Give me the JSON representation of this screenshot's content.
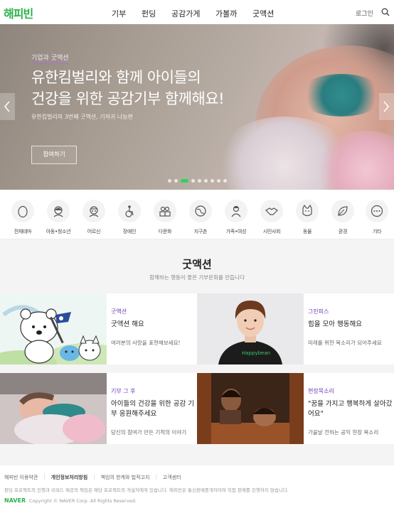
{
  "header": {
    "logo": "해피빈",
    "nav": [
      "기부",
      "펀딩",
      "공감가게",
      "가볼까",
      "굿액션"
    ],
    "login": "로그인",
    "search_icon": "search-icon"
  },
  "hero": {
    "tag": "기업과 굿액션",
    "title_line1": "유한킴벌리와 함께 아이들의",
    "title_line2": "건강을 위한 공감기부 함께해요!",
    "subtitle": "유한킴벌리의 3번째 굿액션, 기저귀 나눔편",
    "button": "참여하기",
    "slide_count": 9,
    "active_slide": 3,
    "accent_color": "#2bd55b"
  },
  "categories": [
    {
      "label": "전체테마",
      "icon": "egg-icon"
    },
    {
      "label": "아동•청소년",
      "icon": "child-icon"
    },
    {
      "label": "어르신",
      "icon": "elder-icon"
    },
    {
      "label": "장애인",
      "icon": "wheelchair-icon"
    },
    {
      "label": "다문화",
      "icon": "people-icon"
    },
    {
      "label": "지구촌",
      "icon": "globe-icon"
    },
    {
      "label": "가족•여성",
      "icon": "woman-icon"
    },
    {
      "label": "시민사회",
      "icon": "handshake-icon"
    },
    {
      "label": "동물",
      "icon": "cat-icon"
    },
    {
      "label": "환경",
      "icon": "leaf-icon"
    },
    {
      "label": "기타",
      "icon": "more-icon"
    }
  ],
  "goodaction": {
    "title": "굿액션",
    "subtitle": "함께하는 행동이 좋은 기부문화를 만듭니다",
    "cards": [
      {
        "kicker": "굿액션",
        "title": "굿액션 해요",
        "desc": "여러분의 사랑을 표현해보세요!"
      },
      {
        "kicker": "그린피스",
        "title": "힘을 모아 행동해요",
        "desc": "미래를 위한 목소리가 되어주세요"
      },
      {
        "kicker": "기부 그 후",
        "title": "아이들의 건강을 위한 공감 기부 응원해주세요",
        "desc": "당신의 참여가 만든 기적의 이야기"
      },
      {
        "kicker": "현장목소리",
        "title": "\"꿈을 가지고 행복하게 살아갔어요\"",
        "desc": "가을날 전하는 공익 현장 목소리"
      }
    ],
    "shirt_text": "Happybean",
    "kicker_color": "#6a3bb8"
  },
  "footer": {
    "links": [
      "해피빈 이용약관",
      "개인정보처리방침",
      "책임의 한계와 법적고지",
      "고객센터"
    ],
    "note": "펀딩 프로젝트의 진행과 리워드 제공의 책임은 해당 프로젝트의 개설자에게 있습니다. 해피빈은 통신판매중개자이며 직접 판매를 진행하지 않습니다.",
    "brand": "NAVER",
    "copyright": "Copyright © NAVER Corp. All Rights Reserved."
  }
}
